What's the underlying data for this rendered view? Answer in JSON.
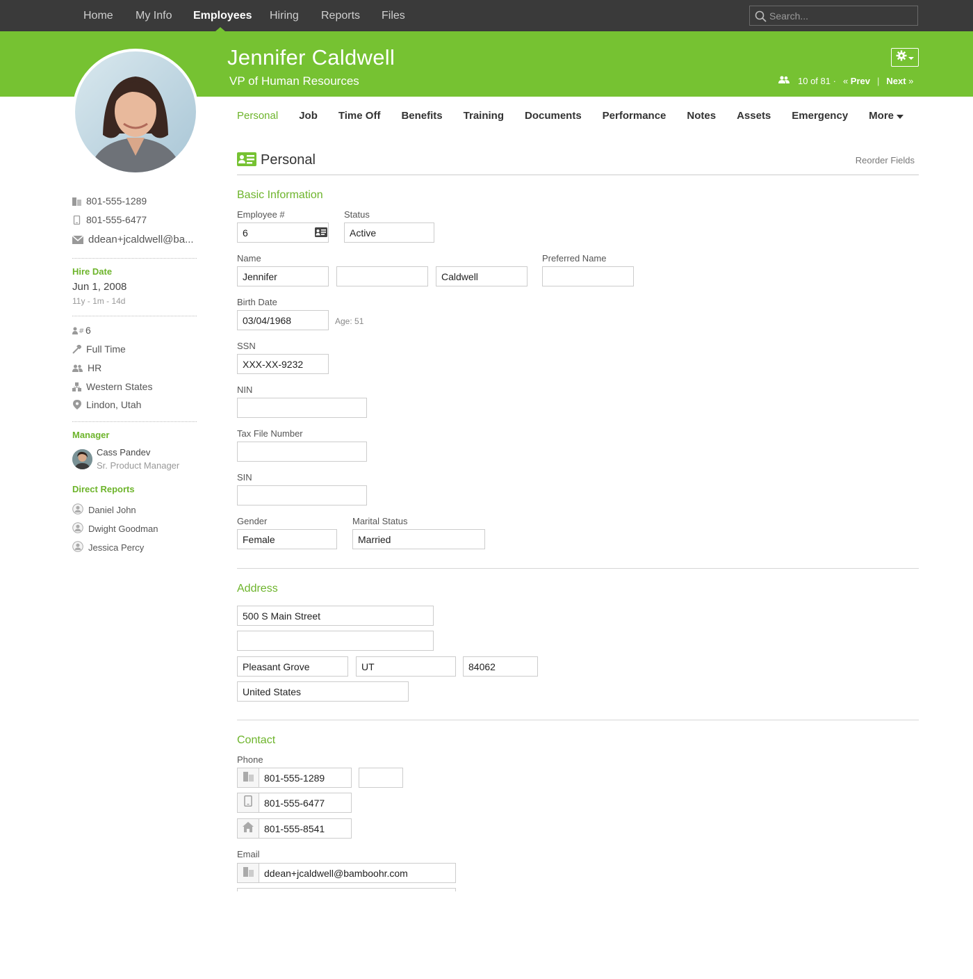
{
  "topnav": {
    "items": [
      "Home",
      "My Info",
      "Employees",
      "Hiring",
      "Reports",
      "Files"
    ],
    "active": "Employees",
    "search_placeholder": "Search..."
  },
  "employee": {
    "name": "Jennifer Caldwell",
    "title": "VP of Human Resources"
  },
  "pager": {
    "position": "10 of 81 ·",
    "prev": "Prev",
    "next": "Next"
  },
  "tabs": [
    "Personal",
    "Job",
    "Time Off",
    "Benefits",
    "Training",
    "Documents",
    "Performance",
    "Notes",
    "Assets",
    "Emergency",
    "More"
  ],
  "sidebar": {
    "work_phone": "801-555-1289",
    "mobile_phone": "801-555-6477",
    "email": "ddean+jcaldwell@ba...",
    "hire_date_label": "Hire Date",
    "hire_date": "Jun 1, 2008",
    "tenure": "11y - 1m - 14d",
    "employee_number": "6",
    "employment_type": "Full Time",
    "department": "HR",
    "division": "Western States",
    "location": "Lindon, Utah",
    "manager_label": "Manager",
    "manager_name": "Cass Pandev",
    "manager_title": "Sr. Product Manager",
    "direct_reports_label": "Direct Reports",
    "direct_reports": [
      "Daniel John",
      "Dwight Goodman",
      "Jessica Percy"
    ]
  },
  "personal": {
    "section_title": "Personal",
    "reorder": "Reorder Fields",
    "basic_info": "Basic Information",
    "labels": {
      "employee_no": "Employee #",
      "status": "Status",
      "name": "Name",
      "preferred_name": "Preferred Name",
      "birth_date": "Birth Date",
      "ssn": "SSN",
      "nin": "NIN",
      "tax_file": "Tax File Number",
      "sin": "SIN",
      "gender": "Gender",
      "marital": "Marital Status"
    },
    "values": {
      "employee_no": "6",
      "status": "Active",
      "first_name": "Jennifer",
      "middle_name": "",
      "last_name": "Caldwell",
      "preferred_name": "",
      "birth_date": "03/04/1968",
      "age": "Age: 51",
      "ssn": "XXX-XX-9232",
      "nin": "",
      "tax_file": "",
      "sin": "",
      "gender": "Female",
      "marital": "Married"
    }
  },
  "address": {
    "title": "Address",
    "street1": "500 S Main Street",
    "street2": "",
    "city": "Pleasant Grove",
    "state": "UT",
    "zip": "84062",
    "country": "United States"
  },
  "contact": {
    "title": "Contact",
    "phone_label": "Phone",
    "work_phone": "801-555-1289",
    "work_ext": "",
    "mobile_phone": "801-555-6477",
    "home_phone": "801-555-8541",
    "email_label": "Email",
    "work_email": "ddean+jcaldwell@bamboohr.com"
  },
  "colors": {
    "brand_green": "#76c232",
    "nav_dark": "#3a3a3a"
  }
}
